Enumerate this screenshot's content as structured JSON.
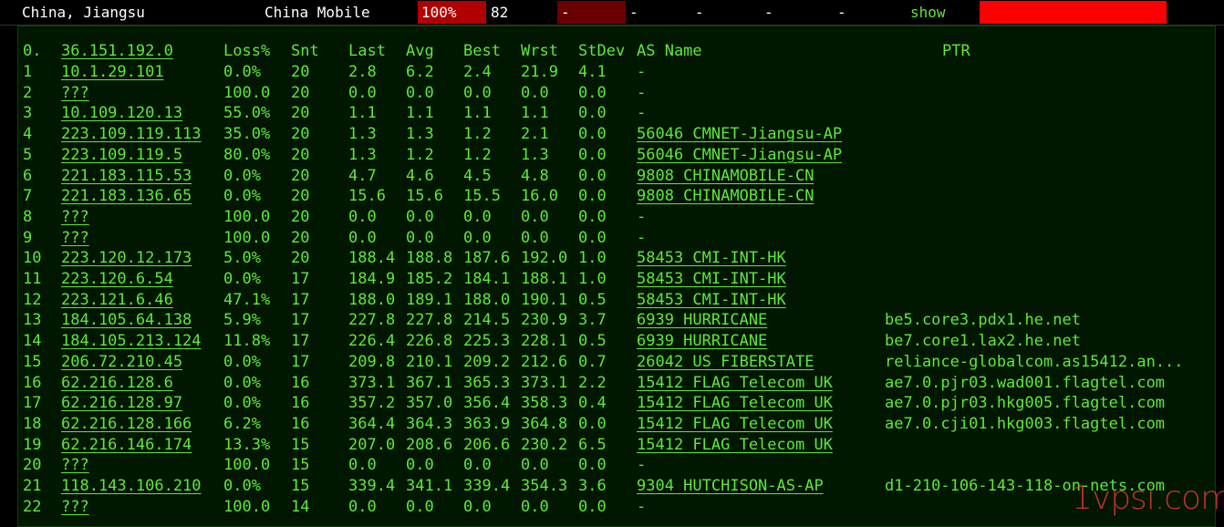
{
  "top_bar": {
    "location": "China, Jiangsu",
    "isp": "China Mobile",
    "loss": "100%",
    "count": "82",
    "dash1": "-",
    "dash2": "-",
    "dash3": "-",
    "dash4": "-",
    "dash5": "-",
    "show": "show"
  },
  "headers": {
    "idx": "0.",
    "host": "36.151.192.0",
    "loss": "Loss%",
    "snt": "Snt",
    "last": "Last",
    "avg": "Avg",
    "best": "Best",
    "wrst": "Wrst",
    "stdev": "StDev",
    "as_name": "AS Name",
    "ptr": "PTR"
  },
  "rows": [
    {
      "idx": "1",
      "host": "10.1.29.101",
      "loss": "0.0%",
      "snt": "20",
      "last": "2.8",
      "avg": "6.2",
      "best": "2.4",
      "wrst": "21.9",
      "stdev": "4.1",
      "as": "-",
      "ptr": ""
    },
    {
      "idx": "2",
      "host": "???",
      "loss": "100.0",
      "snt": "20",
      "last": "0.0",
      "avg": "0.0",
      "best": "0.0",
      "wrst": "0.0",
      "stdev": "0.0",
      "as": "-",
      "ptr": ""
    },
    {
      "idx": "3",
      "host": "10.109.120.13",
      "loss": "55.0%",
      "snt": "20",
      "last": "1.1",
      "avg": "1.1",
      "best": "1.1",
      "wrst": "1.1",
      "stdev": "0.0",
      "as": "-",
      "ptr": ""
    },
    {
      "idx": "4",
      "host": "223.109.119.113",
      "loss": "35.0%",
      "snt": "20",
      "last": "1.3",
      "avg": "1.3",
      "best": "1.2",
      "wrst": "2.1",
      "stdev": "0.0",
      "as": "56046  CMNET-Jiangsu-AP",
      "ptr": ""
    },
    {
      "idx": "5",
      "host": "223.109.119.5",
      "loss": "80.0%",
      "snt": "20",
      "last": "1.3",
      "avg": "1.2",
      "best": "1.2",
      "wrst": "1.3",
      "stdev": "0.0",
      "as": "56046  CMNET-Jiangsu-AP",
      "ptr": ""
    },
    {
      "idx": "6",
      "host": "221.183.115.53",
      "loss": "0.0%",
      "snt": "20",
      "last": "4.7",
      "avg": "4.6",
      "best": "4.5",
      "wrst": "4.8",
      "stdev": "0.0",
      "as": "9808   CHINAMOBILE-CN",
      "ptr": ""
    },
    {
      "idx": "7",
      "host": "221.183.136.65",
      "loss": "0.0%",
      "snt": "20",
      "last": "15.6",
      "avg": "15.6",
      "best": "15.5",
      "wrst": "16.0",
      "stdev": "0.0",
      "as": "9808   CHINAMOBILE-CN",
      "ptr": ""
    },
    {
      "idx": "8",
      "host": "???",
      "loss": "100.0",
      "snt": "20",
      "last": "0.0",
      "avg": "0.0",
      "best": "0.0",
      "wrst": "0.0",
      "stdev": "0.0",
      "as": "-",
      "ptr": ""
    },
    {
      "idx": "9",
      "host": "???",
      "loss": "100.0",
      "snt": "20",
      "last": "0.0",
      "avg": "0.0",
      "best": "0.0",
      "wrst": "0.0",
      "stdev": "0.0",
      "as": "-",
      "ptr": ""
    },
    {
      "idx": "10",
      "host": "223.120.12.173",
      "loss": "5.0%",
      "snt": "20",
      "last": "188.4",
      "avg": "188.8",
      "best": "187.6",
      "wrst": "192.0",
      "stdev": "1.0",
      "as": "58453  CMI-INT-HK",
      "ptr": ""
    },
    {
      "idx": "11",
      "host": "223.120.6.54",
      "loss": "0.0%",
      "snt": "17",
      "last": "184.9",
      "avg": "185.2",
      "best": "184.1",
      "wrst": "188.1",
      "stdev": "1.0",
      "as": "58453  CMI-INT-HK",
      "ptr": ""
    },
    {
      "idx": "12",
      "host": "223.121.6.46",
      "loss": "47.1%",
      "snt": "17",
      "last": "188.0",
      "avg": "189.1",
      "best": "188.0",
      "wrst": "190.1",
      "stdev": "0.5",
      "as": "58453  CMI-INT-HK",
      "ptr": ""
    },
    {
      "idx": "13",
      "host": "184.105.64.138",
      "loss": "5.9%",
      "snt": "17",
      "last": "227.8",
      "avg": "227.8",
      "best": "214.5",
      "wrst": "230.9",
      "stdev": "3.7",
      "as": "6939   HURRICANE",
      "ptr": "be5.core3.pdx1.he.net"
    },
    {
      "idx": "14",
      "host": "184.105.213.124",
      "loss": "11.8%",
      "snt": "17",
      "last": "226.4",
      "avg": "226.8",
      "best": "225.3",
      "wrst": "228.1",
      "stdev": "0.5",
      "as": "6939   HURRICANE",
      "ptr": "be7.core1.lax2.he.net"
    },
    {
      "idx": "15",
      "host": "206.72.210.45",
      "loss": "0.0%",
      "snt": "17",
      "last": "209.8",
      "avg": "210.1",
      "best": "209.2",
      "wrst": "212.6",
      "stdev": "0.7",
      "as": "26042  US FIBERSTATE",
      "ptr": "reliance-globalcom.as15412.an..."
    },
    {
      "idx": "16",
      "host": "62.216.128.6",
      "loss": "0.0%",
      "snt": "16",
      "last": "373.1",
      "avg": "367.1",
      "best": "365.3",
      "wrst": "373.1",
      "stdev": "2.2",
      "as": "15412  FLAG Telecom UK",
      "ptr": "ae7.0.pjr03.wad001.flagtel.com"
    },
    {
      "idx": "17",
      "host": "62.216.128.97",
      "loss": "0.0%",
      "snt": "16",
      "last": "357.2",
      "avg": "357.0",
      "best": "356.4",
      "wrst": "358.3",
      "stdev": "0.4",
      "as": "15412  FLAG Telecom UK",
      "ptr": "ae7.0.pjr03.hkg005.flagtel.com"
    },
    {
      "idx": "18",
      "host": "62.216.128.166",
      "loss": "6.2%",
      "snt": "16",
      "last": "364.4",
      "avg": "364.3",
      "best": "363.9",
      "wrst": "364.8",
      "stdev": "0.0",
      "as": "15412  FLAG Telecom UK",
      "ptr": "ae7.0.cji01.hkg003.flagtel.com"
    },
    {
      "idx": "19",
      "host": "62.216.146.174",
      "loss": "13.3%",
      "snt": "15",
      "last": "207.0",
      "avg": "208.6",
      "best": "206.6",
      "wrst": "230.2",
      "stdev": "6.5",
      "as": "15412  FLAG Telecom UK",
      "ptr": ""
    },
    {
      "idx": "20",
      "host": "???",
      "loss": "100.0",
      "snt": "15",
      "last": "0.0",
      "avg": "0.0",
      "best": "0.0",
      "wrst": "0.0",
      "stdev": "0.0",
      "as": "-",
      "ptr": ""
    },
    {
      "idx": "21",
      "host": "118.143.106.210",
      "loss": "0.0%",
      "snt": "15",
      "last": "339.4",
      "avg": "341.1",
      "best": "339.4",
      "wrst": "354.3",
      "stdev": "3.6",
      "as": "9304   HUTCHISON-AS-AP",
      "ptr": "d1-210-106-143-118-on-nets.com"
    },
    {
      "idx": "22",
      "host": "???",
      "loss": "100.0",
      "snt": "14",
      "last": "0.0",
      "avg": "0.0",
      "best": "0.0",
      "wrst": "0.0",
      "stdev": "0.0",
      "as": "-",
      "ptr": ""
    }
  ],
  "watermark": "1vpsi.com"
}
